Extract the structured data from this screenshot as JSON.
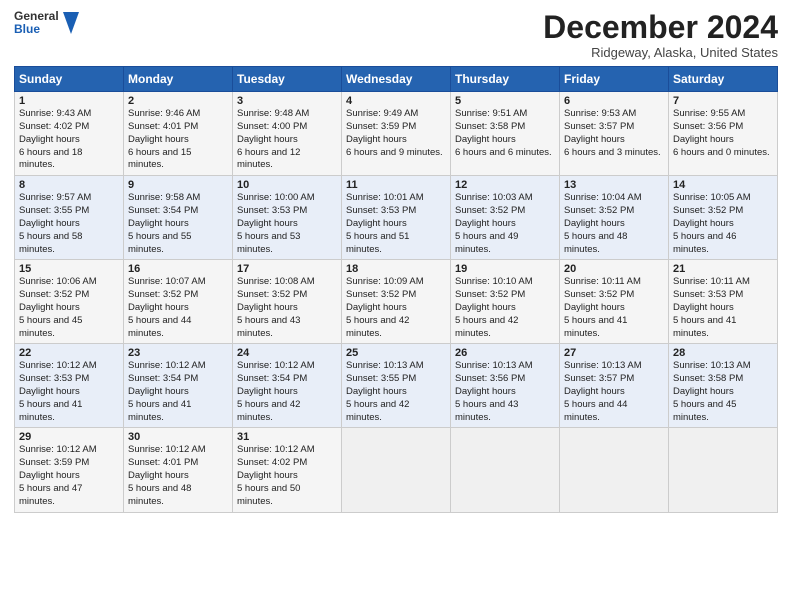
{
  "logo": {
    "general": "General",
    "blue": "Blue"
  },
  "title": "December 2024",
  "location": "Ridgeway, Alaska, United States",
  "days_of_week": [
    "Sunday",
    "Monday",
    "Tuesday",
    "Wednesday",
    "Thursday",
    "Friday",
    "Saturday"
  ],
  "weeks": [
    [
      {
        "num": "1",
        "rise": "9:43 AM",
        "set": "4:02 PM",
        "daylight": "6 hours and 18 minutes."
      },
      {
        "num": "2",
        "rise": "9:46 AM",
        "set": "4:01 PM",
        "daylight": "6 hours and 15 minutes."
      },
      {
        "num": "3",
        "rise": "9:48 AM",
        "set": "4:00 PM",
        "daylight": "6 hours and 12 minutes."
      },
      {
        "num": "4",
        "rise": "9:49 AM",
        "set": "3:59 PM",
        "daylight": "6 hours and 9 minutes."
      },
      {
        "num": "5",
        "rise": "9:51 AM",
        "set": "3:58 PM",
        "daylight": "6 hours and 6 minutes."
      },
      {
        "num": "6",
        "rise": "9:53 AM",
        "set": "3:57 PM",
        "daylight": "6 hours and 3 minutes."
      },
      {
        "num": "7",
        "rise": "9:55 AM",
        "set": "3:56 PM",
        "daylight": "6 hours and 0 minutes."
      }
    ],
    [
      {
        "num": "8",
        "rise": "9:57 AM",
        "set": "3:55 PM",
        "daylight": "5 hours and 58 minutes."
      },
      {
        "num": "9",
        "rise": "9:58 AM",
        "set": "3:54 PM",
        "daylight": "5 hours and 55 minutes."
      },
      {
        "num": "10",
        "rise": "10:00 AM",
        "set": "3:53 PM",
        "daylight": "5 hours and 53 minutes."
      },
      {
        "num": "11",
        "rise": "10:01 AM",
        "set": "3:53 PM",
        "daylight": "5 hours and 51 minutes."
      },
      {
        "num": "12",
        "rise": "10:03 AM",
        "set": "3:52 PM",
        "daylight": "5 hours and 49 minutes."
      },
      {
        "num": "13",
        "rise": "10:04 AM",
        "set": "3:52 PM",
        "daylight": "5 hours and 48 minutes."
      },
      {
        "num": "14",
        "rise": "10:05 AM",
        "set": "3:52 PM",
        "daylight": "5 hours and 46 minutes."
      }
    ],
    [
      {
        "num": "15",
        "rise": "10:06 AM",
        "set": "3:52 PM",
        "daylight": "5 hours and 45 minutes."
      },
      {
        "num": "16",
        "rise": "10:07 AM",
        "set": "3:52 PM",
        "daylight": "5 hours and 44 minutes."
      },
      {
        "num": "17",
        "rise": "10:08 AM",
        "set": "3:52 PM",
        "daylight": "5 hours and 43 minutes."
      },
      {
        "num": "18",
        "rise": "10:09 AM",
        "set": "3:52 PM",
        "daylight": "5 hours and 42 minutes."
      },
      {
        "num": "19",
        "rise": "10:10 AM",
        "set": "3:52 PM",
        "daylight": "5 hours and 42 minutes."
      },
      {
        "num": "20",
        "rise": "10:11 AM",
        "set": "3:52 PM",
        "daylight": "5 hours and 41 minutes."
      },
      {
        "num": "21",
        "rise": "10:11 AM",
        "set": "3:53 PM",
        "daylight": "5 hours and 41 minutes."
      }
    ],
    [
      {
        "num": "22",
        "rise": "10:12 AM",
        "set": "3:53 PM",
        "daylight": "5 hours and 41 minutes."
      },
      {
        "num": "23",
        "rise": "10:12 AM",
        "set": "3:54 PM",
        "daylight": "5 hours and 41 minutes."
      },
      {
        "num": "24",
        "rise": "10:12 AM",
        "set": "3:54 PM",
        "daylight": "5 hours and 42 minutes."
      },
      {
        "num": "25",
        "rise": "10:13 AM",
        "set": "3:55 PM",
        "daylight": "5 hours and 42 minutes."
      },
      {
        "num": "26",
        "rise": "10:13 AM",
        "set": "3:56 PM",
        "daylight": "5 hours and 43 minutes."
      },
      {
        "num": "27",
        "rise": "10:13 AM",
        "set": "3:57 PM",
        "daylight": "5 hours and 44 minutes."
      },
      {
        "num": "28",
        "rise": "10:13 AM",
        "set": "3:58 PM",
        "daylight": "5 hours and 45 minutes."
      }
    ],
    [
      {
        "num": "29",
        "rise": "10:12 AM",
        "set": "3:59 PM",
        "daylight": "5 hours and 47 minutes."
      },
      {
        "num": "30",
        "rise": "10:12 AM",
        "set": "4:01 PM",
        "daylight": "5 hours and 48 minutes."
      },
      {
        "num": "31",
        "rise": "10:12 AM",
        "set": "4:02 PM",
        "daylight": "5 hours and 50 minutes."
      },
      null,
      null,
      null,
      null
    ]
  ]
}
